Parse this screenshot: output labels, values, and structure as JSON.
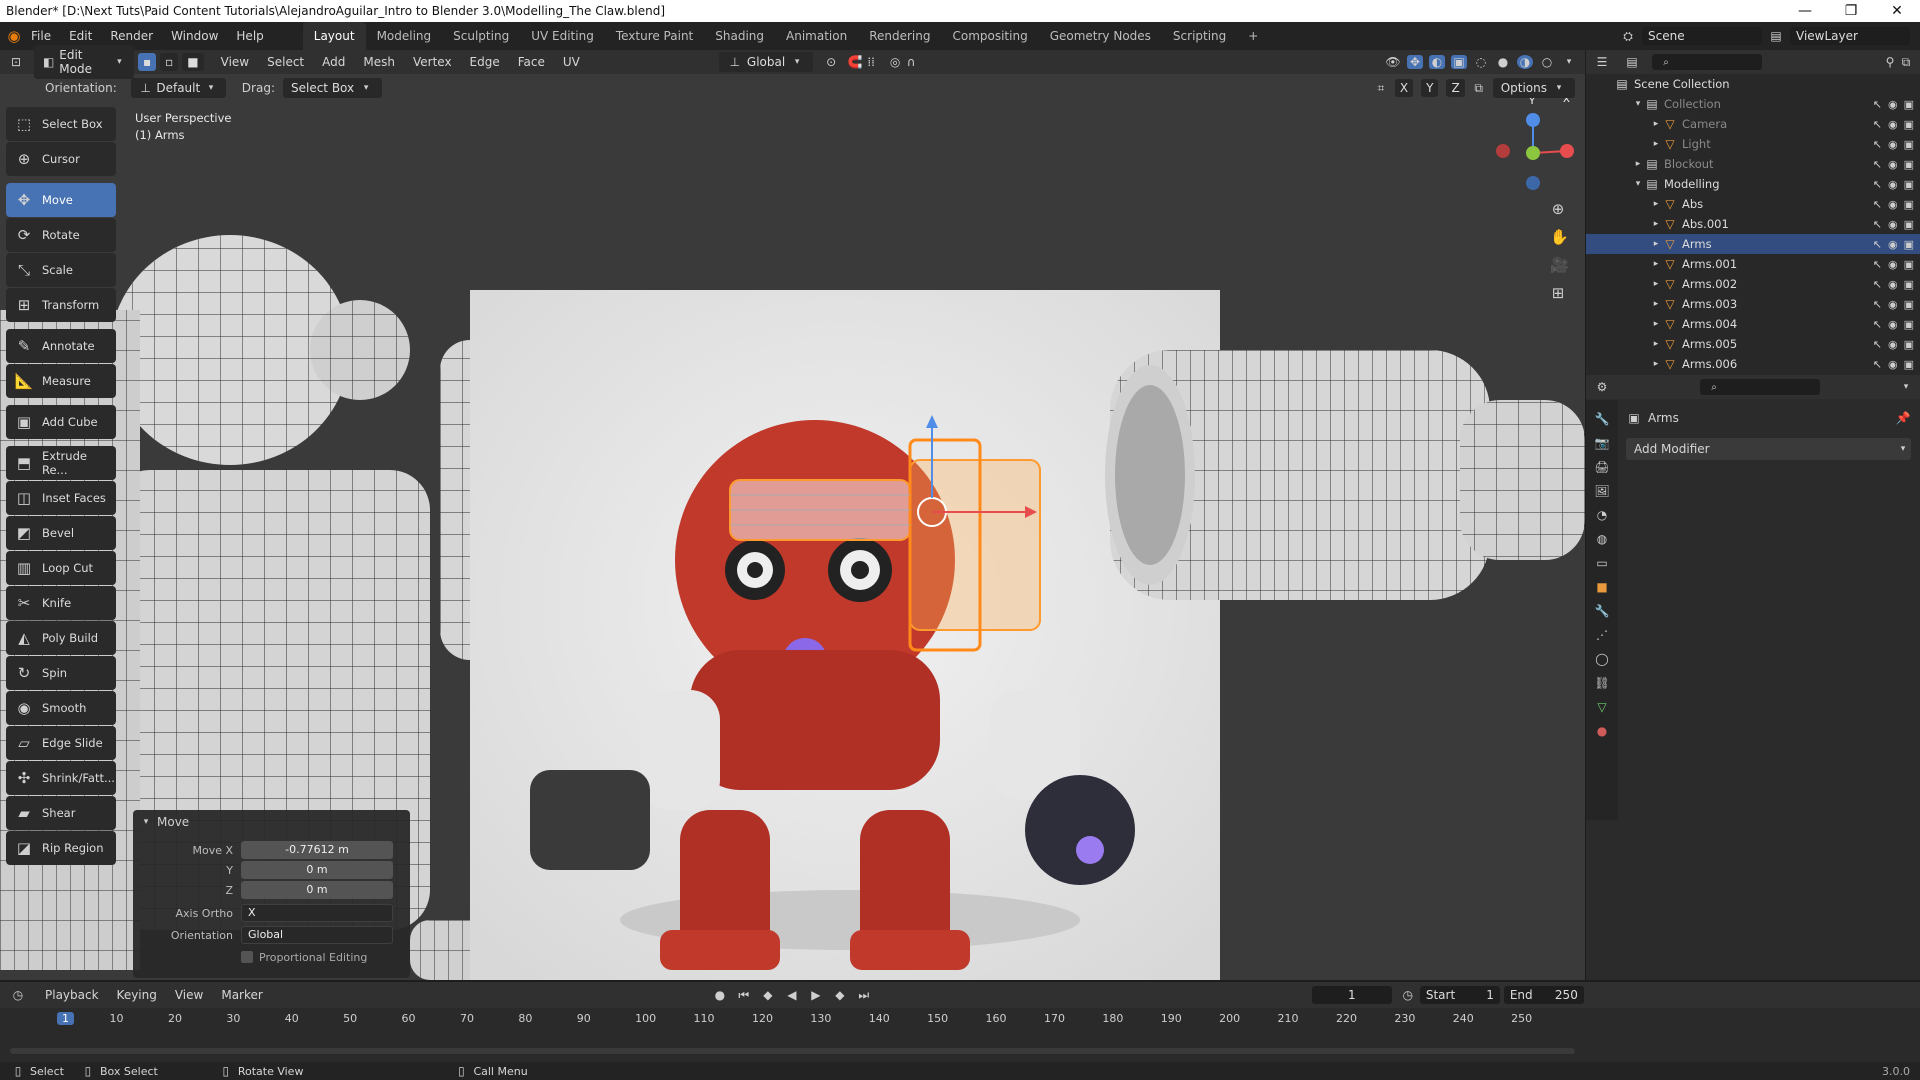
{
  "window": {
    "title": "Blender* [D:\\Next Tuts\\Paid Content Tutorials\\AlejandroAguilar_Intro to Blender 3.0\\Modelling_The Claw.blend]",
    "controls": [
      "—",
      "❐",
      "✕"
    ]
  },
  "menus": [
    "File",
    "Edit",
    "Render",
    "Window",
    "Help"
  ],
  "workspaces": [
    "Layout",
    "Modeling",
    "Sculpting",
    "UV Editing",
    "Texture Paint",
    "Shading",
    "Animation",
    "Rendering",
    "Compositing",
    "Geometry Nodes",
    "Scripting",
    "+"
  ],
  "active_workspace": "Layout",
  "scene": {
    "label": "Scene",
    "view_layer": "ViewLayer"
  },
  "viewport_header": {
    "mode": "Edit Mode",
    "menus": [
      "View",
      "Select",
      "Add",
      "Mesh",
      "Vertex",
      "Edge",
      "Face",
      "UV"
    ],
    "transform_orientation": "Global",
    "orientation_label": "Orientation:",
    "orientation_value": "Default",
    "drag_label": "Drag:",
    "drag_value": "Select Box",
    "axes": [
      "X",
      "Y",
      "Z"
    ],
    "options": "Options"
  },
  "viewport_info": {
    "line1": "User Perspective",
    "line2": "(1) Arms"
  },
  "gizmo": {
    "x": "X",
    "y": "Y",
    "z": "Z"
  },
  "tools": [
    {
      "name": "select-box",
      "label": "Select Box",
      "icon": "⬚"
    },
    {
      "name": "cursor",
      "label": "Cursor",
      "icon": "⊕"
    },
    {
      "name": "move",
      "label": "Move",
      "icon": "✥",
      "active": true
    },
    {
      "name": "rotate",
      "label": "Rotate",
      "icon": "⟳"
    },
    {
      "name": "scale",
      "label": "Scale",
      "icon": "⤡"
    },
    {
      "name": "transform",
      "label": "Transform",
      "icon": "⊞"
    },
    {
      "name": "annotate",
      "label": "Annotate",
      "icon": "✎"
    },
    {
      "name": "measure",
      "label": "Measure",
      "icon": "📐"
    },
    {
      "name": "add-cube",
      "label": "Add Cube",
      "icon": "▣"
    },
    {
      "name": "extrude",
      "label": "Extrude Re...",
      "icon": "⬒"
    },
    {
      "name": "inset-faces",
      "label": "Inset Faces",
      "icon": "◫"
    },
    {
      "name": "bevel",
      "label": "Bevel",
      "icon": "◩"
    },
    {
      "name": "loop-cut",
      "label": "Loop Cut",
      "icon": "▥"
    },
    {
      "name": "knife",
      "label": "Knife",
      "icon": "✂"
    },
    {
      "name": "poly-build",
      "label": "Poly Build",
      "icon": "◭"
    },
    {
      "name": "spin",
      "label": "Spin",
      "icon": "↻"
    },
    {
      "name": "smooth",
      "label": "Smooth",
      "icon": "◉"
    },
    {
      "name": "edge-slide",
      "label": "Edge Slide",
      "icon": "▱"
    },
    {
      "name": "shrink-fatten",
      "label": "Shrink/Fatt...",
      "icon": "✣"
    },
    {
      "name": "shear",
      "label": "Shear",
      "icon": "▰"
    },
    {
      "name": "rip-region",
      "label": "Rip Region",
      "icon": "◪"
    }
  ],
  "operator_panel": {
    "title": "Move",
    "move_x_label": "Move X",
    "move_x": "-0.77612 m",
    "y_label": "Y",
    "y": "0 m",
    "z_label": "Z",
    "z": "0 m",
    "axis_ortho_label": "Axis Ortho",
    "axis_ortho": "X",
    "orientation_label": "Orientation",
    "orientation": "Global",
    "proportional": "Proportional Editing"
  },
  "outliner": {
    "root": "Scene Collection",
    "items": [
      {
        "label": "Collection",
        "indent": 1,
        "dim": true
      },
      {
        "label": "Camera",
        "indent": 2,
        "dim": true
      },
      {
        "label": "Light",
        "indent": 2,
        "dim": true
      },
      {
        "label": "Blockout",
        "indent": 1,
        "dim": true
      },
      {
        "label": "Modelling",
        "indent": 1
      },
      {
        "label": "Abs",
        "indent": 2
      },
      {
        "label": "Abs.001",
        "indent": 2
      },
      {
        "label": "Arms",
        "indent": 2,
        "selected": true
      },
      {
        "label": "Arms.001",
        "indent": 2
      },
      {
        "label": "Arms.002",
        "indent": 2
      },
      {
        "label": "Arms.003",
        "indent": 2
      },
      {
        "label": "Arms.004",
        "indent": 2
      },
      {
        "label": "Arms.005",
        "indent": 2
      },
      {
        "label": "Arms.006",
        "indent": 2
      }
    ]
  },
  "properties": {
    "object": "Arms",
    "add_modifier": "Add Modifier"
  },
  "timeline": {
    "menus": [
      "Playback",
      "Keying",
      "View",
      "Marker"
    ],
    "current_frame": "1",
    "start_label": "Start",
    "start": "1",
    "end_label": "End",
    "end": "250",
    "ticks": [
      "1",
      "10",
      "20",
      "30",
      "40",
      "50",
      "60",
      "70",
      "80",
      "90",
      "100",
      "110",
      "120",
      "130",
      "140",
      "150",
      "160",
      "170",
      "180",
      "190",
      "200",
      "210",
      "220",
      "230",
      "240",
      "250"
    ]
  },
  "statusbar": {
    "select": "Select",
    "box_select": "Box Select",
    "rotate_view": "Rotate View",
    "call_menu": "Call Menu",
    "version": "3.0.0"
  }
}
